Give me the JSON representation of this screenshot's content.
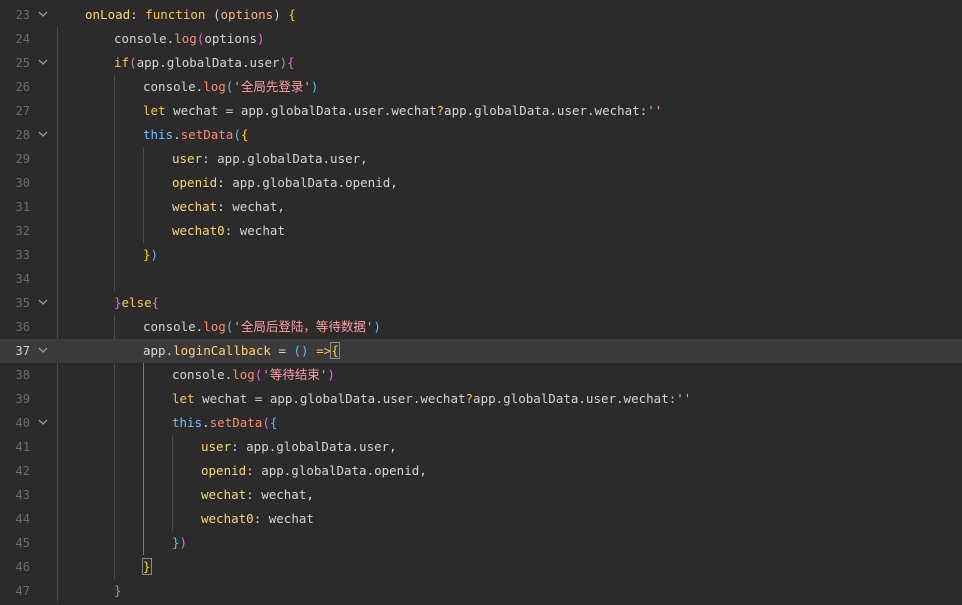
{
  "editor": {
    "active_line": 37,
    "colors": {
      "background": "#2b2b2b",
      "active_line_background": "#3a3a3a",
      "line_number": "#6c6c6c",
      "indent_guide": "#4a4a4a",
      "indent_guide_active": "#8a6aa6",
      "keyword": "#ffc44d",
      "function": "#ff8a6e",
      "string": "#ff9d9d",
      "this": "#6fc0ff"
    },
    "lines": [
      {
        "num": "23",
        "fold": true,
        "indent": 0,
        "tokens": [
          [
            "prop",
            "onLoad"
          ],
          [
            "punct",
            ": "
          ],
          [
            "keyword",
            "function"
          ],
          [
            "plain",
            " ("
          ],
          [
            "param",
            "options"
          ],
          [
            "plain",
            ") "
          ],
          [
            "bracket1",
            "{"
          ]
        ]
      },
      {
        "num": "24",
        "fold": false,
        "indent": 1,
        "tokens": [
          [
            "plain",
            "console."
          ],
          [
            "func",
            "log"
          ],
          [
            "bracket2",
            "("
          ],
          [
            "plain",
            "options"
          ],
          [
            "bracket2",
            ")"
          ]
        ]
      },
      {
        "num": "25",
        "fold": true,
        "indent": 1,
        "tokens": [
          [
            "keyword",
            "if"
          ],
          [
            "bracket2",
            "("
          ],
          [
            "plain",
            "app.globalData.user"
          ],
          [
            "bracket2",
            ")"
          ],
          [
            "bracket2",
            "{"
          ]
        ]
      },
      {
        "num": "26",
        "fold": false,
        "indent": 2,
        "tokens": [
          [
            "plain",
            "console."
          ],
          [
            "func",
            "log"
          ],
          [
            "bracket3",
            "("
          ],
          [
            "string",
            "'全局先登录'"
          ],
          [
            "bracket3",
            ")"
          ]
        ]
      },
      {
        "num": "27",
        "fold": false,
        "indent": 2,
        "tokens": [
          [
            "keyword",
            "let"
          ],
          [
            "plain",
            " wechat = app.globalData.user.wechat"
          ],
          [
            "keyword",
            "?"
          ],
          [
            "plain",
            "app.globalData.user.wechat"
          ],
          [
            "keyword",
            ":"
          ],
          [
            "string",
            "''"
          ]
        ]
      },
      {
        "num": "28",
        "fold": true,
        "indent": 2,
        "tokens": [
          [
            "this",
            "this"
          ],
          [
            "plain",
            "."
          ],
          [
            "func",
            "setData"
          ],
          [
            "bracket3",
            "("
          ],
          [
            "bracket1",
            "{"
          ]
        ]
      },
      {
        "num": "29",
        "fold": false,
        "indent": 3,
        "tokens": [
          [
            "prop",
            "user"
          ],
          [
            "plain",
            ": app.globalData.user,"
          ]
        ]
      },
      {
        "num": "30",
        "fold": false,
        "indent": 3,
        "tokens": [
          [
            "prop",
            "openid"
          ],
          [
            "plain",
            ": app.globalData.openid,"
          ]
        ]
      },
      {
        "num": "31",
        "fold": false,
        "indent": 3,
        "tokens": [
          [
            "prop",
            "wechat"
          ],
          [
            "plain",
            ": wechat,"
          ]
        ]
      },
      {
        "num": "32",
        "fold": false,
        "indent": 3,
        "tokens": [
          [
            "prop",
            "wechat0"
          ],
          [
            "plain",
            ": wechat"
          ]
        ]
      },
      {
        "num": "33",
        "fold": false,
        "indent": 2,
        "tokens": [
          [
            "bracket1",
            "}"
          ],
          [
            "bracket3",
            ")"
          ]
        ]
      },
      {
        "num": "34",
        "fold": false,
        "indent": 2,
        "tokens": []
      },
      {
        "num": "35",
        "fold": true,
        "indent": 1,
        "tokens": [
          [
            "bracket2",
            "}"
          ],
          [
            "keyword",
            "else"
          ],
          [
            "bracket2",
            "{"
          ]
        ]
      },
      {
        "num": "36",
        "fold": false,
        "indent": 2,
        "tokens": [
          [
            "plain",
            "console."
          ],
          [
            "func",
            "log"
          ],
          [
            "bracket3",
            "("
          ],
          [
            "string",
            "'全局后登陆，等待数据'"
          ],
          [
            "bracket3",
            ")"
          ]
        ]
      },
      {
        "num": "37",
        "fold": true,
        "indent": 2,
        "tokens": [
          [
            "plain",
            "app."
          ],
          [
            "prop",
            "loginCallback"
          ],
          [
            "plain",
            " = "
          ],
          [
            "bracket3",
            "()"
          ],
          [
            "plain",
            " "
          ],
          [
            "keyword",
            "=>"
          ],
          [
            "bracket1",
            "{"
          ]
        ]
      },
      {
        "num": "38",
        "fold": false,
        "indent": 3,
        "tokens": [
          [
            "plain",
            "console."
          ],
          [
            "func",
            "log"
          ],
          [
            "bracket2",
            "("
          ],
          [
            "string",
            "'等待结束'"
          ],
          [
            "bracket2",
            ")"
          ]
        ]
      },
      {
        "num": "39",
        "fold": false,
        "indent": 3,
        "tokens": [
          [
            "keyword",
            "let"
          ],
          [
            "plain",
            " wechat = app.globalData.user.wechat"
          ],
          [
            "keyword",
            "?"
          ],
          [
            "plain",
            "app.globalData.user.wechat"
          ],
          [
            "keyword",
            ":"
          ],
          [
            "string",
            "''"
          ]
        ]
      },
      {
        "num": "40",
        "fold": true,
        "indent": 3,
        "tokens": [
          [
            "this",
            "this"
          ],
          [
            "plain",
            "."
          ],
          [
            "func",
            "setData"
          ],
          [
            "bracket2",
            "("
          ],
          [
            "bracket3",
            "{"
          ]
        ]
      },
      {
        "num": "41",
        "fold": false,
        "indent": 4,
        "tokens": [
          [
            "prop",
            "user"
          ],
          [
            "plain",
            ": app.globalData.user,"
          ]
        ]
      },
      {
        "num": "42",
        "fold": false,
        "indent": 4,
        "tokens": [
          [
            "prop",
            "openid"
          ],
          [
            "plain",
            ": app.globalData.openid,"
          ]
        ]
      },
      {
        "num": "43",
        "fold": false,
        "indent": 4,
        "tokens": [
          [
            "prop",
            "wechat"
          ],
          [
            "plain",
            ": wechat,"
          ]
        ]
      },
      {
        "num": "44",
        "fold": false,
        "indent": 4,
        "tokens": [
          [
            "prop",
            "wechat0"
          ],
          [
            "plain",
            ": wechat"
          ]
        ]
      },
      {
        "num": "45",
        "fold": false,
        "indent": 3,
        "tokens": [
          [
            "bracket3",
            "}"
          ],
          [
            "bracket2",
            ")"
          ]
        ]
      },
      {
        "num": "46",
        "fold": false,
        "indent": 2,
        "tokens": [
          [
            "bracket1",
            "}"
          ]
        ]
      },
      {
        "num": "47",
        "fold": false,
        "indent": 1,
        "tokens": [
          [
            "bracket2",
            "}"
          ]
        ]
      }
    ]
  }
}
